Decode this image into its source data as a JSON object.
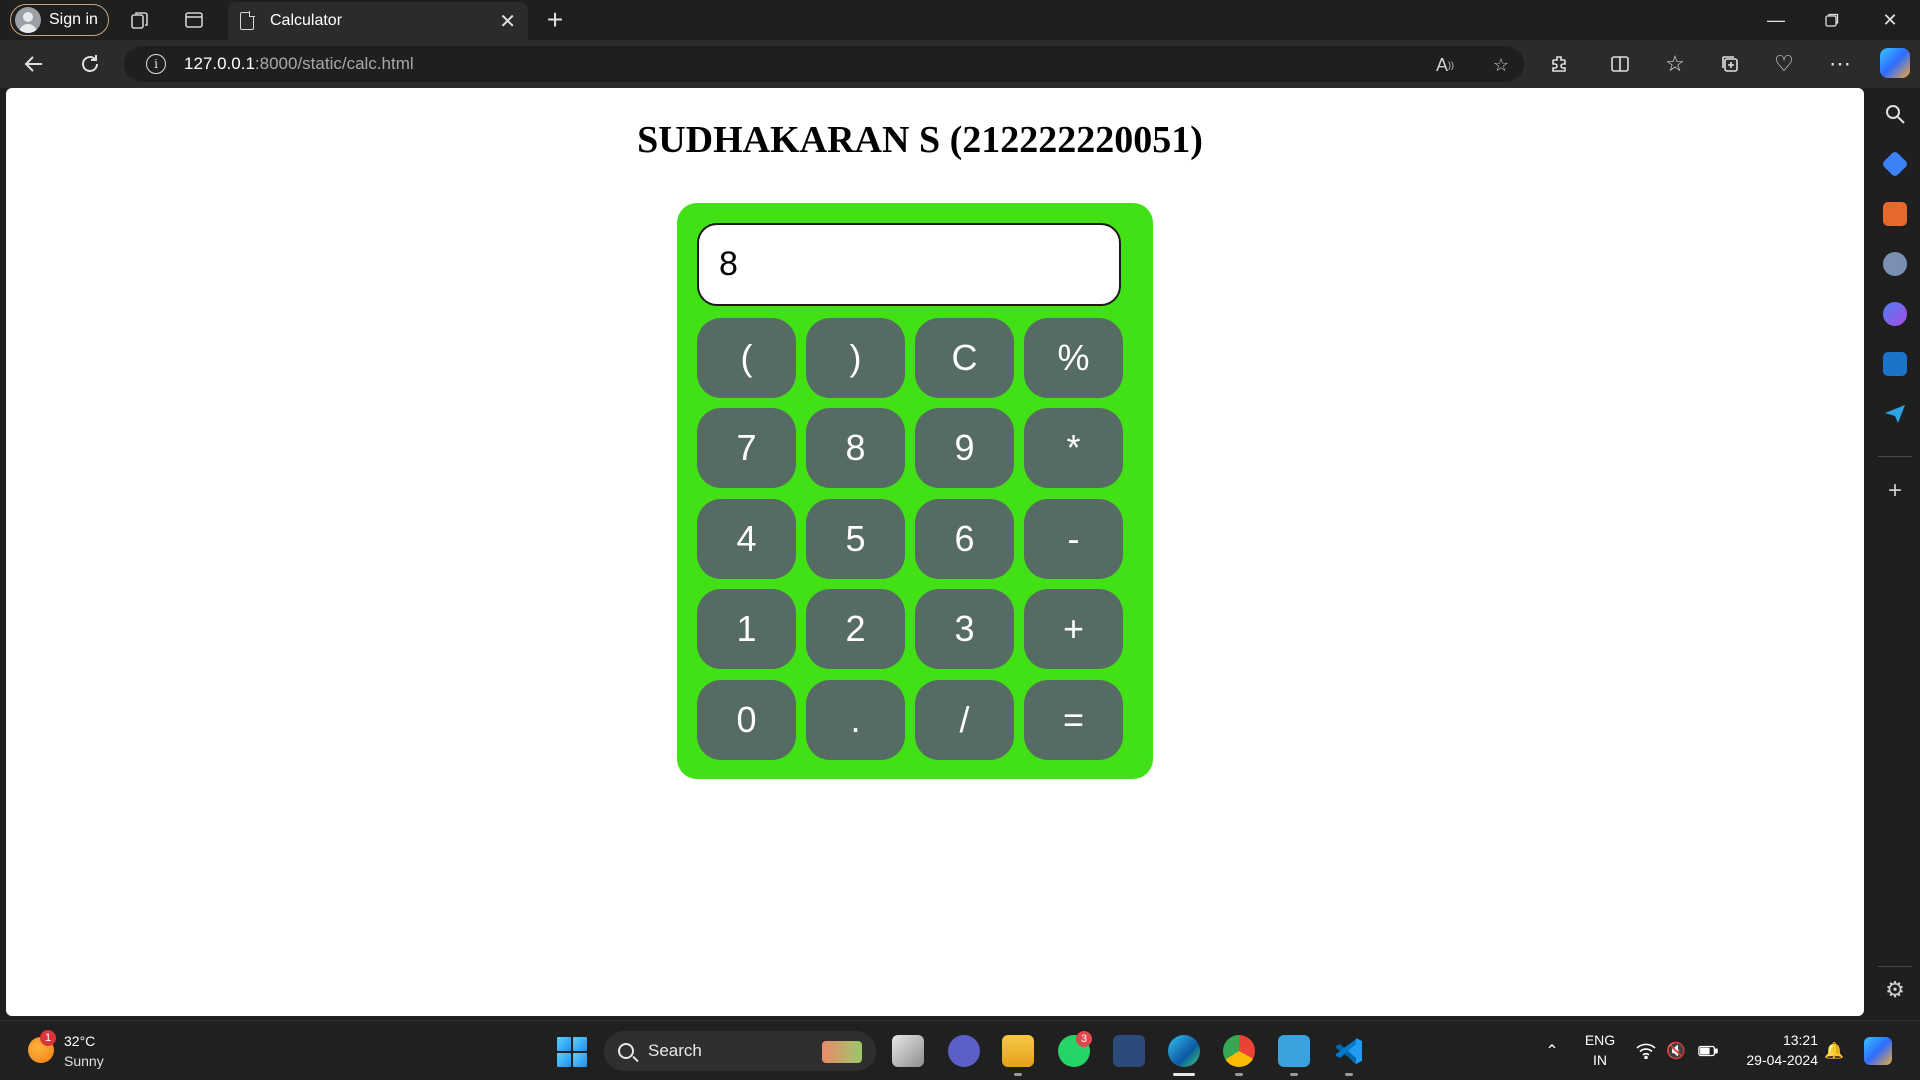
{
  "browser": {
    "profile_label": "Sign in",
    "tab_title": "Calculator",
    "url_host": "127.0.0.1",
    "url_path": ":8000/static/calc.html"
  },
  "page": {
    "title": "SUDHAKARAN S (212222220051)"
  },
  "calculator": {
    "display_value": "8",
    "keys": [
      [
        "(",
        ")",
        "C",
        "%"
      ],
      [
        "7",
        "8",
        "9",
        "*"
      ],
      [
        "4",
        "5",
        "6",
        "-"
      ],
      [
        "1",
        "2",
        "3",
        "+"
      ],
      [
        "0",
        ".",
        "/",
        "="
      ]
    ],
    "colors": {
      "body": "#42e116",
      "key": "#566b63",
      "display_bg": "#ffffff"
    }
  },
  "taskbar": {
    "weather_badge": "1",
    "weather_temp": "32°C",
    "weather_condition": "Sunny",
    "search_label": "Search",
    "whatsapp_badge": "3",
    "lang_line1": "ENG",
    "lang_line2": "IN",
    "time": "13:21",
    "date": "29-04-2024"
  }
}
